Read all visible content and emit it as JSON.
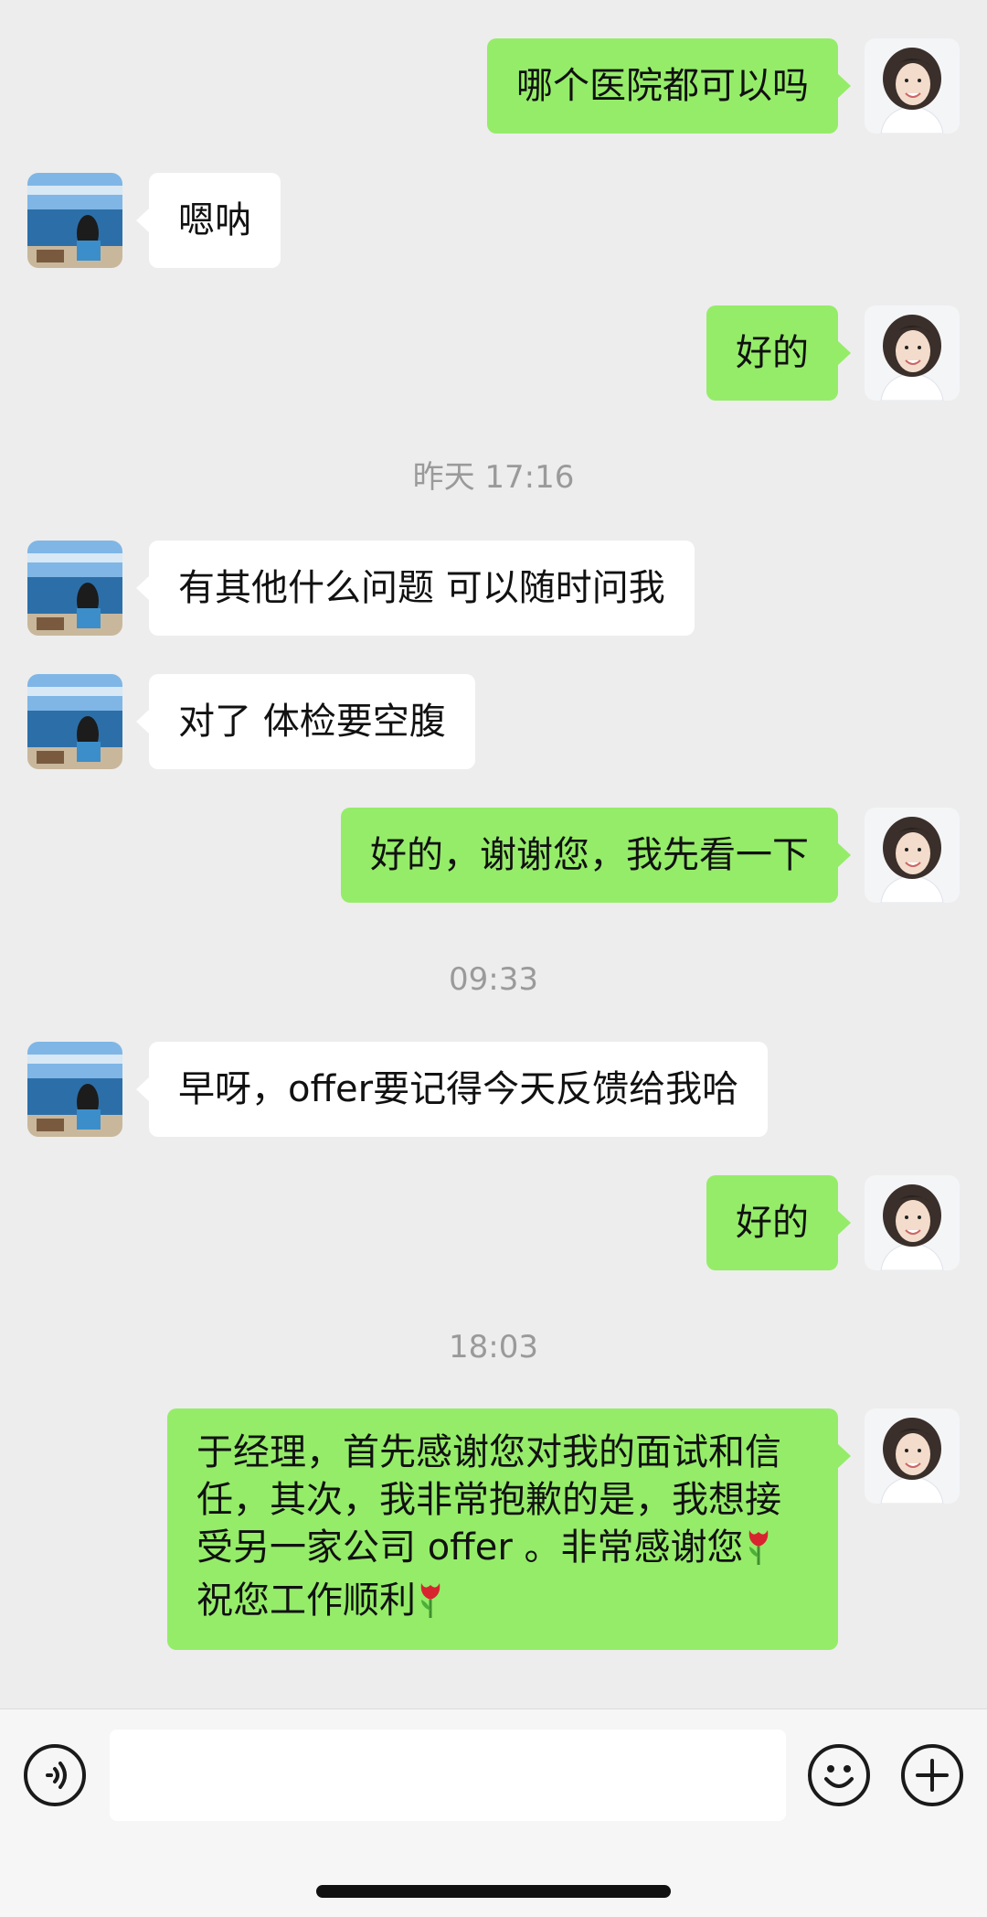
{
  "messages": [
    {
      "side": "self",
      "text": "哪个医院都可以吗"
    },
    {
      "side": "other",
      "text": "嗯呐"
    },
    {
      "side": "self",
      "text": "好的"
    },
    {
      "timestamp": "昨天 17:16"
    },
    {
      "side": "other",
      "text": "有其他什么问题 可以随时问我"
    },
    {
      "side": "other",
      "text": "对了 体检要空腹"
    },
    {
      "side": "self",
      "text": "好的，谢谢您，我先看一下"
    },
    {
      "timestamp": "09:33"
    },
    {
      "side": "other",
      "text": "早呀，offer要记得今天反馈给我哈"
    },
    {
      "side": "self",
      "text": "好的"
    },
    {
      "timestamp": "18:03"
    },
    {
      "side": "self",
      "text_part1": "于经理，首先感谢您对我的面试和信任，其次，我非常抱歉的是，我想接受另一家公司 offer 。非常感谢您",
      "text_part2": "祝您工作顺利",
      "emoji": "tulip"
    }
  ],
  "input_bar": {
    "placeholder": "",
    "left_icon": "voice-icon",
    "right_icons": [
      "emoji-icon",
      "plus-icon"
    ]
  },
  "colors": {
    "background": "#ededed",
    "self_bubble": "#95ec69",
    "other_bubble": "#ffffff",
    "timestamp": "#9a9a9a"
  }
}
